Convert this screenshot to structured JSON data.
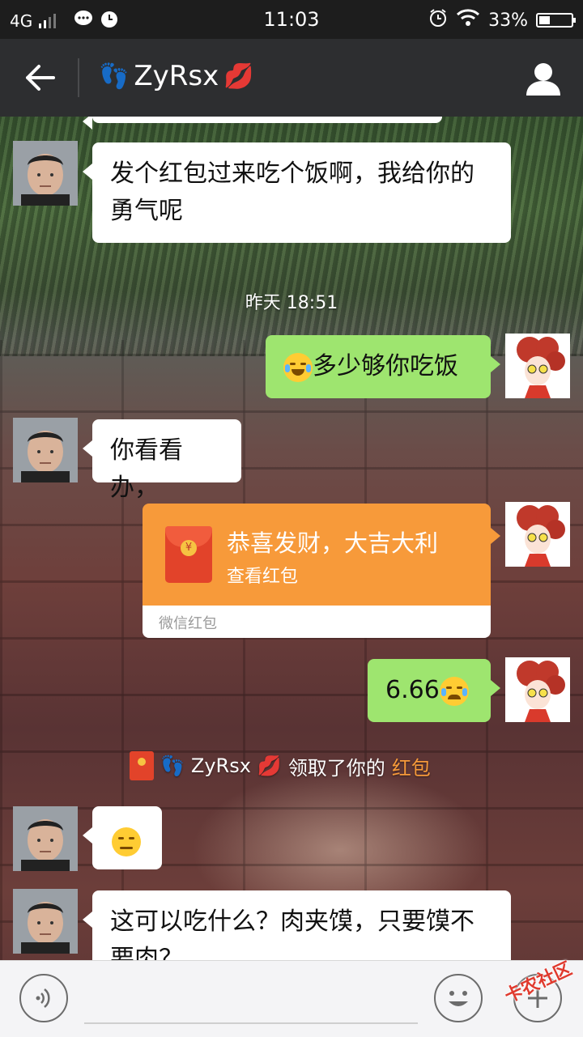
{
  "status_bar": {
    "network": "4G",
    "time": "11:03",
    "battery_percent": "33%",
    "battery_level": 0.33
  },
  "header": {
    "contact_name": "ZyRsx",
    "prefix_emoji": "👣",
    "suffix_emoji": "💋"
  },
  "messages": [
    {
      "side": "left",
      "type": "text",
      "text": "发个红包过来吃个饭啊，我给你的勇气呢"
    },
    {
      "type": "time",
      "text": "昨天 18:51"
    },
    {
      "side": "right",
      "type": "text",
      "emoji": "laugh-cry",
      "text": "多少够你吃饭"
    },
    {
      "side": "left",
      "type": "text",
      "text": "你看看办，"
    },
    {
      "side": "right",
      "type": "red_packet",
      "title": "恭喜发财，大吉大利",
      "action": "查看红包",
      "label": "微信红包"
    },
    {
      "side": "right",
      "type": "text",
      "text": "6.66",
      "emoji": "crying"
    },
    {
      "type": "notice",
      "name": "ZyRsx",
      "text": "领取了你的",
      "link": "红包"
    },
    {
      "side": "left",
      "type": "emoji",
      "emoji": "unamused"
    },
    {
      "side": "left",
      "type": "text",
      "text": "这可以吃什么？肉夹馍，只要馍不要肉？"
    }
  ],
  "input_bar": {
    "voice_icon": "voice-icon",
    "emoji_icon": "emoji-icon",
    "plus_icon": "plus-icon"
  },
  "watermark": "卡农社区"
}
